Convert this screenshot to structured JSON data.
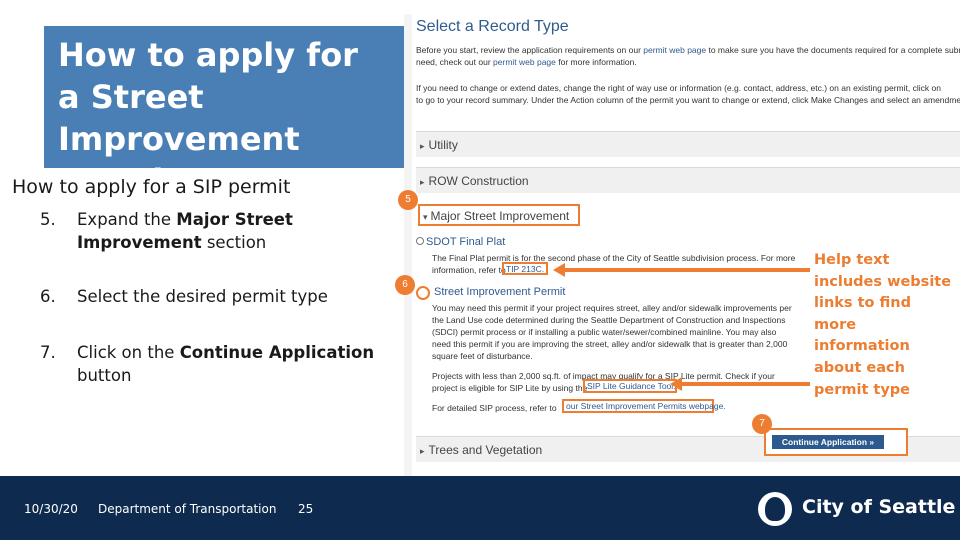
{
  "slide": {
    "title": "How to apply for a Street Improvement Permit",
    "subtitle": "How to apply for a SIP permit",
    "steps": [
      {
        "num": "5.",
        "pre": "Expand the ",
        "bold": "Major Street Improvement",
        "post": " section"
      },
      {
        "num": "6.",
        "pre": "Select the desired permit type",
        "bold": "",
        "post": ""
      },
      {
        "num": "7.",
        "pre": "Click on the ",
        "bold": "Continue Application",
        "post": " button"
      }
    ],
    "help_text": "Help text includes website links to find more information about each permit type"
  },
  "screenshot": {
    "title": "Select a Record Type",
    "para1_line1_pre": "Before you start, review the application requirements on our ",
    "para1_link": "permit web page",
    "para1_line1_post": " to make sure you have the documents required for a complete submittal.",
    "para1_line2_pre": "need, check out our ",
    "para1_line2_link": "permit web page",
    "para1_line2_post": " for more information.",
    "para2_line1": "If you need to change or extend dates, change the right of way use or information (e.g. contact, address, etc.) on an existing permit, click on",
    "para2_line2": "to go to your record summary. Under the Action column of the permit you want to change or extend, click Make Changes and select an amendment type",
    "sections": {
      "utility": "Utility",
      "row": "ROW Construction",
      "major": "Major Street Improvement",
      "trees": "Trees and Vegetation"
    },
    "option1_title": "SDOT Final Plat",
    "option1_line1": "The Final Plat permit is for the second phase of the City of Seattle subdivision process. For more",
    "option1_line2": "information, refer to",
    "tip_link": "TIP 213C.",
    "option2_title": "Street Improvement Permit",
    "option2_lines": [
      "You may need this permit if your project requires street, alley and/or sidewalk improvements per",
      "the Land Use code determined during the Seattle Department of Construction and Inspections",
      "(SDCI) permit process or if installing a public water/sewer/combined mainline. You may also",
      "need this permit if you are improving the street, alley and/or sidewalk that is greater than 2,000",
      "square feet of disturbance."
    ],
    "sip_lite_line1": "Projects with less than 2,000 sq.ft. of impact may qualify for a SIP Lite permit. Check if your",
    "sip_lite_line2": "project is eligible for SIP Lite by using the",
    "sip_lite_link": "SIP Lite Guidance Tool.",
    "detail_text": "For detailed SIP process, refer to",
    "detail_link": "our Street Improvement Permits webpage.",
    "continue_button": "Continue Application »"
  },
  "badges": {
    "b5": "5",
    "b6": "6",
    "b7": "7"
  },
  "footer": {
    "date": "10/30/20",
    "department": "Department of Transportation",
    "page": "25",
    "logo_text": "City of Seattle"
  },
  "colors": {
    "accent": "#ed7d31",
    "title_bg": "#4a7fb5",
    "footer_bg": "#0e2a4e",
    "link": "#2f5b8f"
  }
}
